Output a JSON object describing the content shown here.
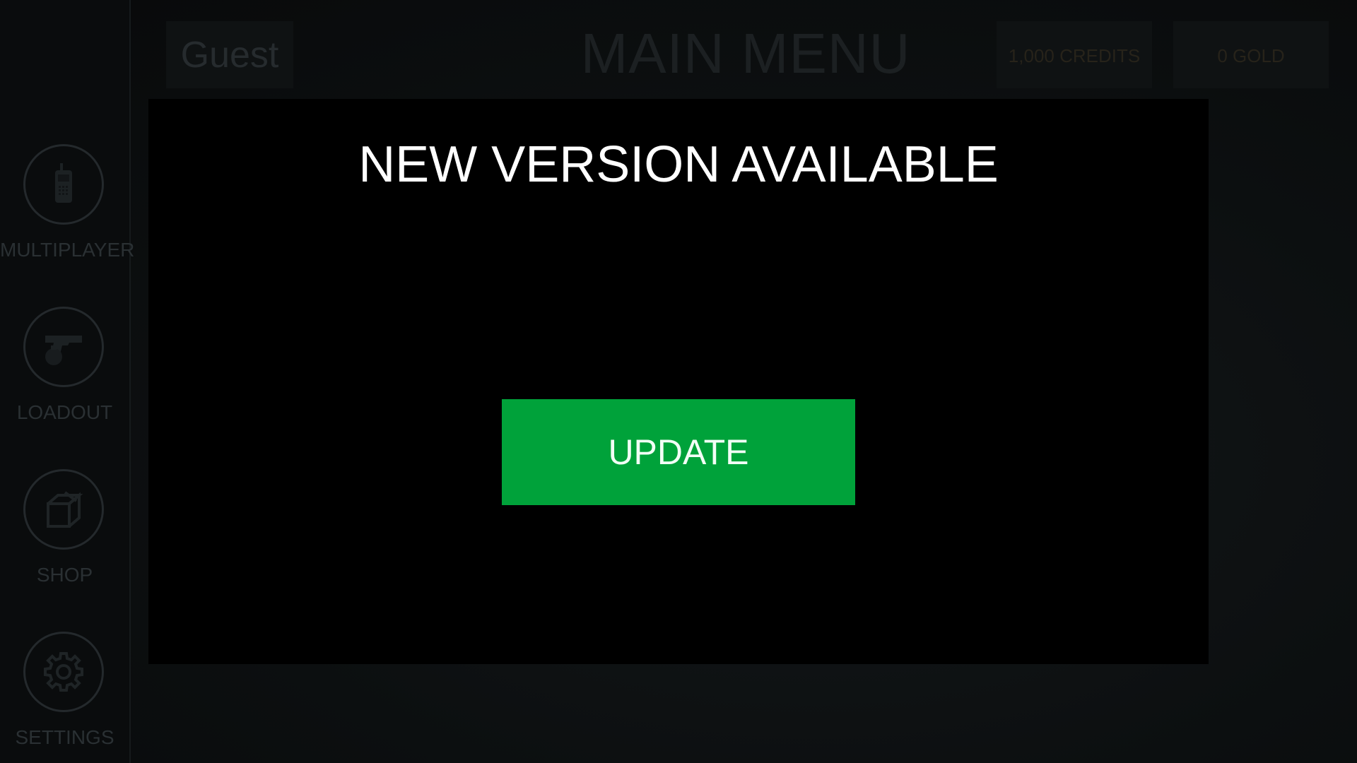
{
  "header": {
    "player_name": "Guest",
    "title": "MAIN MENU",
    "credits": "1,000 CREDITS",
    "gold": "0 GOLD"
  },
  "sidebar": {
    "items": [
      {
        "label": "MULTIPLAYER",
        "icon": "walkie-talkie-icon"
      },
      {
        "label": "LOADOUT",
        "icon": "pistol-grenade-icon"
      },
      {
        "label": "SHOP",
        "icon": "crate-icon"
      },
      {
        "label": "SETTINGS",
        "icon": "gear-icon"
      }
    ]
  },
  "modal": {
    "title": "NEW VERSION AVAILABLE",
    "button_label": "UPDATE",
    "button_color": "#00a23a"
  },
  "colors": {
    "background": "#0d1012",
    "modal_background": "#000000",
    "dim_text": "#2a3033"
  }
}
